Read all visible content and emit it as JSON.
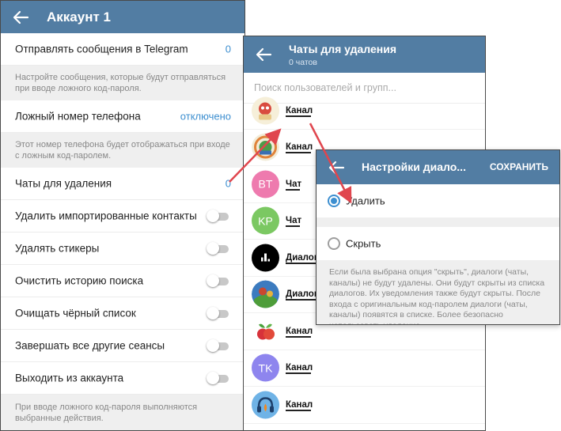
{
  "colors": {
    "header": "#527da3",
    "accent": "#3d8fd0",
    "arrow": "#e0464e"
  },
  "account": {
    "title": "Аккаунт 1",
    "send_messages": {
      "label": "Отправлять сообщения в Telegram",
      "value": "0"
    },
    "send_hint": "Настройте сообщения, которые будут отправляться при вводе ложного код-пароля.",
    "fake_phone": {
      "label": "Ложный номер телефона",
      "value": "отключено"
    },
    "phone_hint": "Этот номер телефона будет отображаться при входе с ложным код-паролем.",
    "chats_to_delete": {
      "label": "Чаты для удаления",
      "value": "0"
    },
    "toggles": [
      {
        "label": "Удалить импортированные контакты",
        "on": false
      },
      {
        "label": "Удалять стикеры",
        "on": false
      },
      {
        "label": "Очистить историю поиска",
        "on": false
      },
      {
        "label": "Очищать чёрный список",
        "on": false
      },
      {
        "label": "Завершать все другие сеансы",
        "on": false
      },
      {
        "label": "Выходить из аккаунта",
        "on": false
      }
    ],
    "footer_hint": "При вводе ложного код-пароля выполняются выбранные действия."
  },
  "chats": {
    "title": "Чаты для удаления",
    "subtitle": "0 чатов",
    "search_placeholder": "Поиск пользователей и групп...",
    "items": [
      {
        "name": "Канал",
        "avatar": "illustration-icon"
      },
      {
        "name": "Канал",
        "avatar": "emblem-icon"
      },
      {
        "name": "Чат",
        "initials": "BT",
        "color": "#ee7aae"
      },
      {
        "name": "Чат",
        "initials": "KP",
        "color": "#7bc862"
      },
      {
        "name": "Диалог",
        "avatar": "bars-icon"
      },
      {
        "name": "Диалог",
        "avatar": "game-icon"
      },
      {
        "name": "Канал",
        "avatar": "apple-icon"
      },
      {
        "name": "Канал",
        "initials": "TK",
        "color": "#8e85ee"
      },
      {
        "name": "Канал",
        "avatar": "headphones-fire-icon"
      }
    ]
  },
  "dialog_settings": {
    "title": "Настройки диало...",
    "save_label": "СОХРАНИТЬ",
    "options": [
      {
        "label": "Удалить",
        "selected": true
      },
      {
        "label": "Скрыть",
        "selected": false
      }
    ],
    "hint": "Если была выбрана опция \"скрыть\", диалоги (чаты, каналы) не будут удалены. Они будут скрыты из списка диалогов. Их уведомления также будут скрыты. После входа с оригинальным код-паролем диалоги (чаты, каналы) появятся в списке. Более безопасно использовать удаление."
  }
}
